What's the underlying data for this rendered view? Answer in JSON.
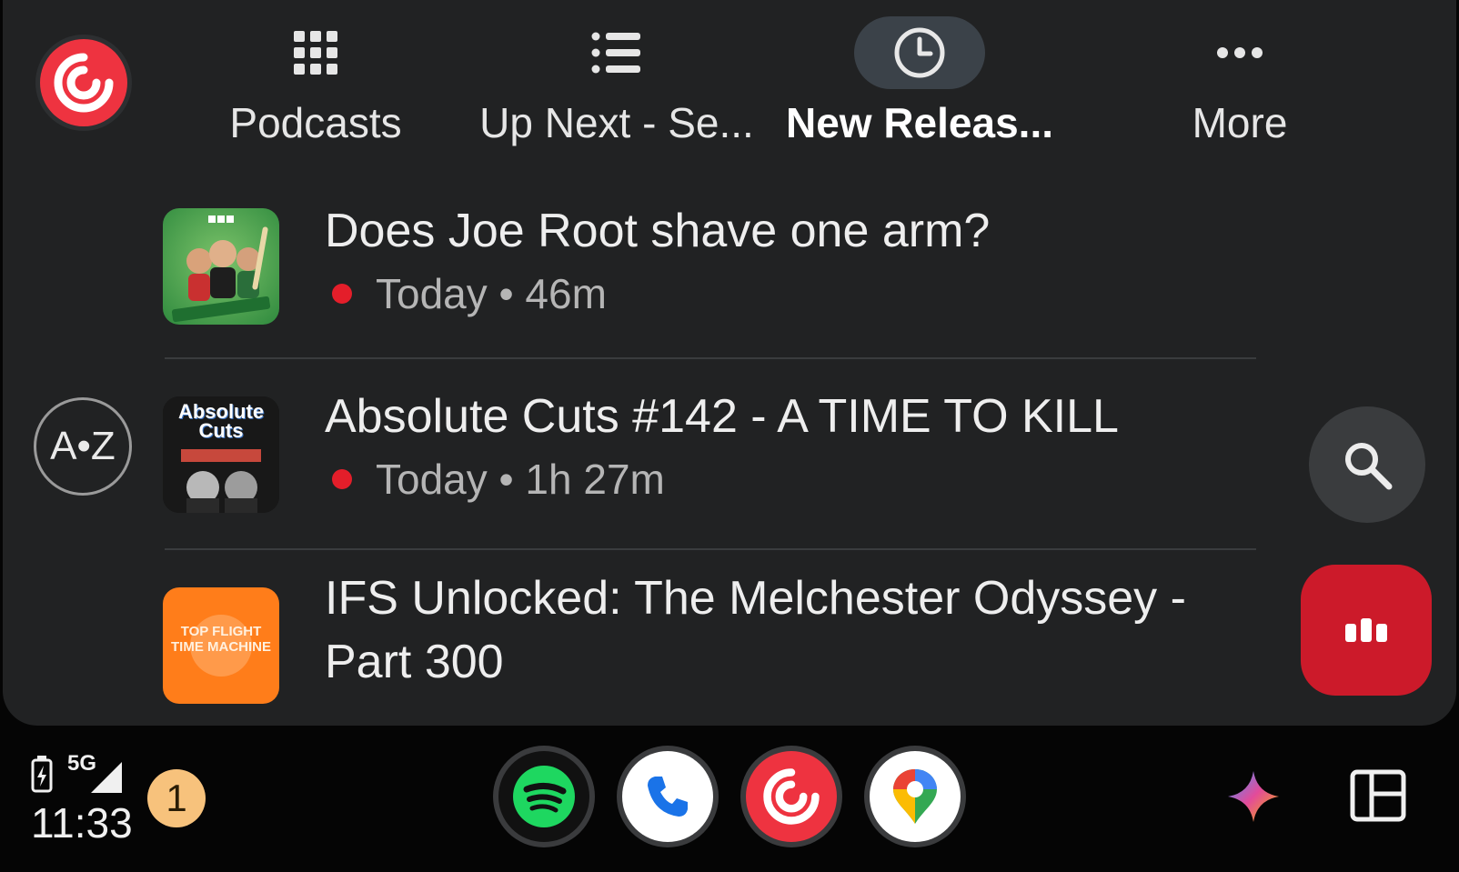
{
  "app": {
    "name": "Pocket Casts",
    "logo_icon": "pocketcasts-logo-icon"
  },
  "tabs": [
    {
      "label": "Podcasts",
      "icon": "grid-icon"
    },
    {
      "label": "Up Next - Se...",
      "icon": "list-icon"
    },
    {
      "label": "New Releas...",
      "icon": "clock-icon",
      "active": true
    },
    {
      "label": "More",
      "icon": "more-dots-icon"
    }
  ],
  "episodes": [
    {
      "title": "Does Joe Root shave one arm?",
      "meta": "Today • 46m",
      "art_icon": "tailenders-artwork"
    },
    {
      "title": "Absolute Cuts #142 - A TIME TO KILL",
      "meta": "Today • 1h 27m",
      "art_icon": "absolute-cuts-artwork",
      "art_text": "Absolute Cuts"
    },
    {
      "title_line1": "IFS Unlocked: The Melchester Odyssey -",
      "title_line2": "Part 300",
      "art_icon": "top-flight-time-machine-artwork",
      "art_text": "TOP FLIGHT TIME MACHINE"
    }
  ],
  "side": {
    "az_label": "A•Z",
    "search_icon": "search-icon",
    "now_playing_icon": "now-playing-icon"
  },
  "statusbar": {
    "time": "11:33",
    "network": "5G",
    "notification_count": "1"
  },
  "dock": [
    {
      "name": "spotify-app",
      "color": "#1ed760"
    },
    {
      "name": "phone-app",
      "color": "#1a73e8"
    },
    {
      "name": "pocketcasts-app",
      "color": "#ee3340"
    },
    {
      "name": "maps-app",
      "color": "#34a853"
    }
  ],
  "colors": {
    "accent": "#ee3340",
    "play_button": "#cc1a2a",
    "unplayed_dot": "#e41e2a",
    "notification": "#f7c27c"
  }
}
